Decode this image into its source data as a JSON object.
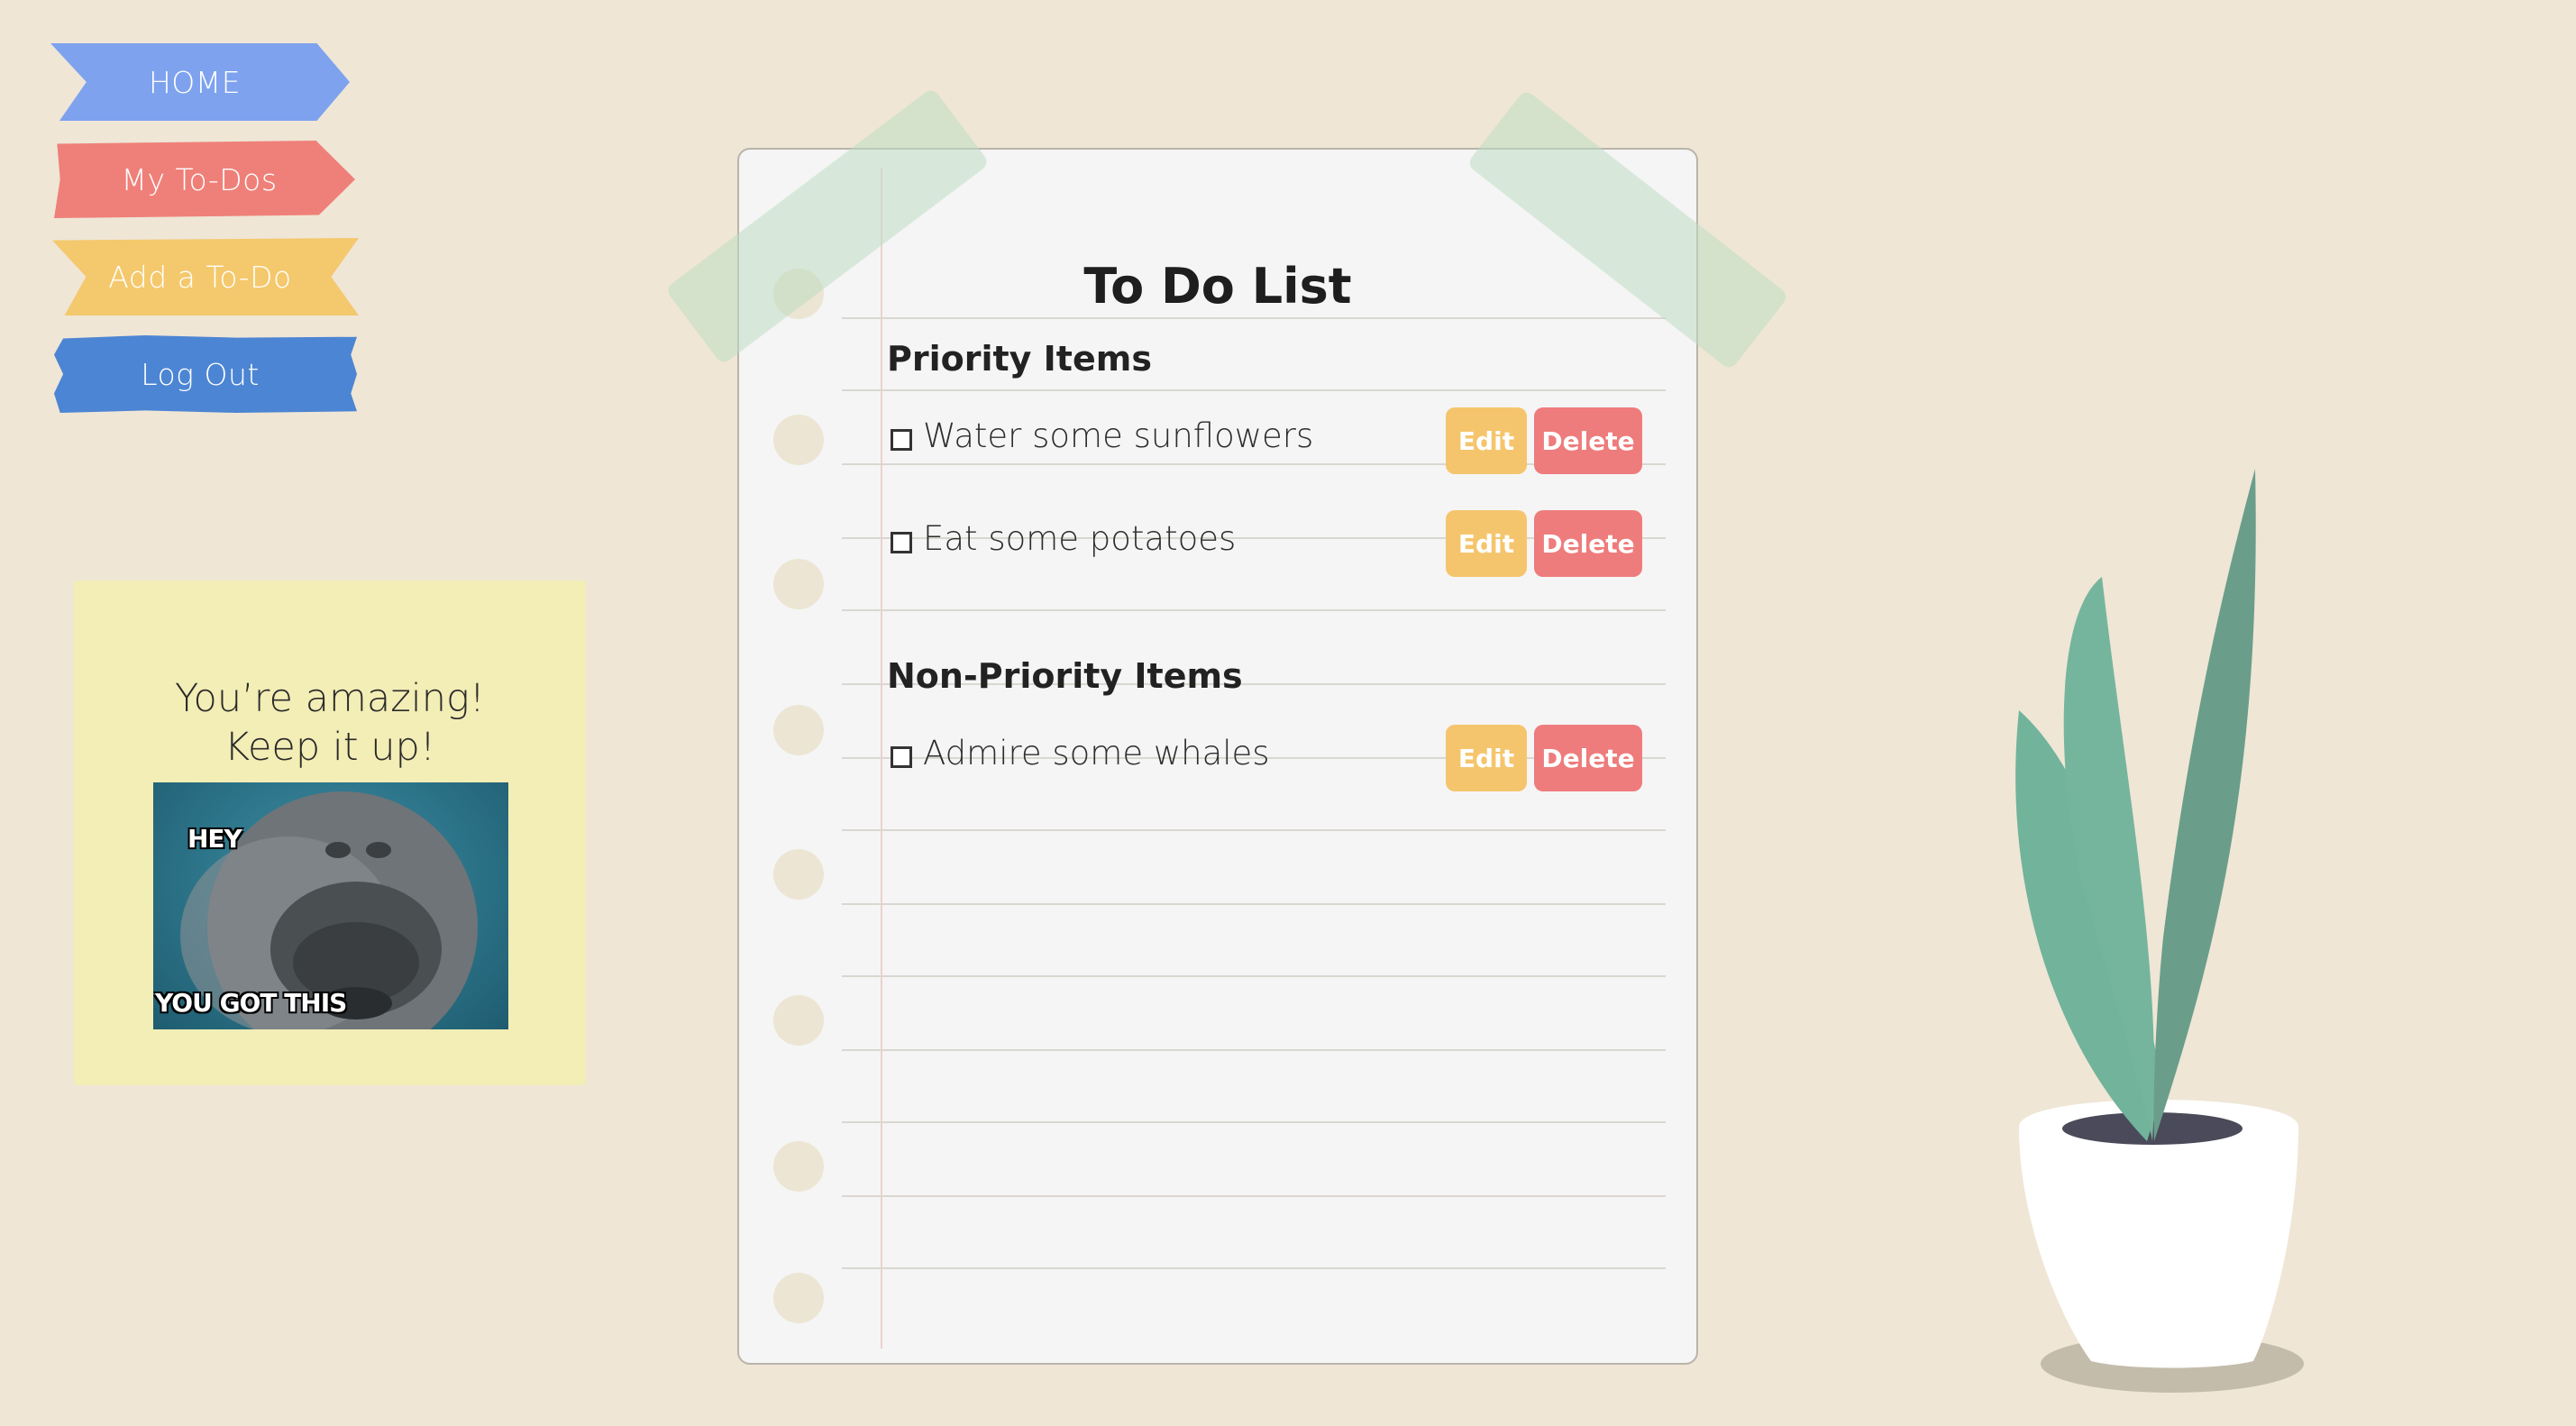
{
  "nav": {
    "home": "HOME",
    "my_todos": "My To-Dos",
    "add_todo": "Add a To-Do",
    "log_out": "Log Out"
  },
  "sticky": {
    "line1": "You’re amazing!",
    "line2": "Keep it up!",
    "meme_top": "HEY",
    "meme_bottom": "YOU GOT THIS"
  },
  "list": {
    "title": "To Do List",
    "priority_heading": "Priority Items",
    "non_priority_heading": "Non-Priority Items",
    "edit_label": "Edit",
    "delete_label": "Delete",
    "priority_items": [
      "Water some sunflowers",
      "Eat some potatoes"
    ],
    "non_priority_items": [
      "Admire some whales"
    ]
  },
  "colors": {
    "background": "#efe6d6",
    "home_ribbon": "#7ea2ee",
    "todos_ribbon": "#ef8079",
    "add_ribbon": "#f4c86c",
    "logout_ribbon": "#4c85d3",
    "edit_button": "#f5c56d",
    "delete_button": "#ee7c7c",
    "sticky_note": "#f3edb6",
    "leaf": "#72b39b"
  }
}
